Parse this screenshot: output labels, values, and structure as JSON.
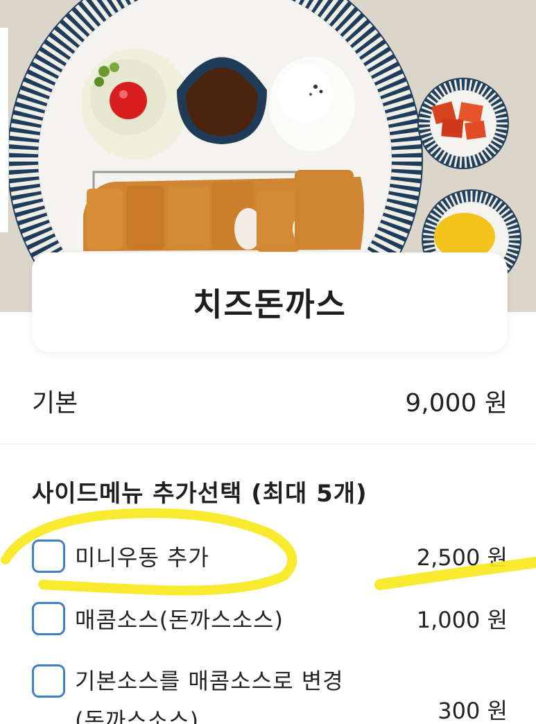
{
  "menu_item": {
    "name": "치즈돈까스"
  },
  "base": {
    "label": "기본",
    "price": "9,000 원"
  },
  "side_menu": {
    "title": "사이드메뉴 추가선택 (최대 5개)",
    "options": [
      {
        "label": "미니우동 추가",
        "price": "2,500 원",
        "checked": false
      },
      {
        "label": "매콤소스(돈까스소스)",
        "price": "1,000 원",
        "checked": false
      },
      {
        "label": "기본소스를 매콤소스로 변경",
        "label_cont": "(돈까스소스)",
        "price": "300 원",
        "checked": false
      }
    ]
  },
  "colors": {
    "checkbox_border": "#3f7fc4",
    "highlighter": "#f7e81c"
  }
}
